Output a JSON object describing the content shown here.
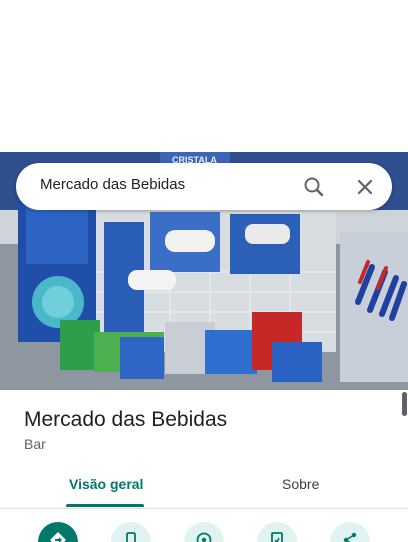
{
  "search": {
    "query": "Mercado das Bebidas"
  },
  "hero": {
    "image": "store-shelf-photo",
    "sign_text": "CRISTALA"
  },
  "place": {
    "name": "Mercado das Bebidas",
    "category": "Bar"
  },
  "tabs": [
    {
      "label": "Visão geral",
      "active": true
    },
    {
      "label": "Sobre",
      "active": false
    }
  ],
  "actions": [
    {
      "icon": "directions-icon",
      "primary": true
    },
    {
      "icon": "phone-icon",
      "primary": false
    },
    {
      "icon": "navigate-icon",
      "primary": false
    },
    {
      "icon": "save-icon",
      "primary": false
    },
    {
      "icon": "share-icon",
      "primary": false
    }
  ],
  "colors": {
    "accent": "#00796b",
    "accent_light": "#e0f2f1",
    "text_primary": "#202124",
    "text_secondary": "#5f6368"
  }
}
